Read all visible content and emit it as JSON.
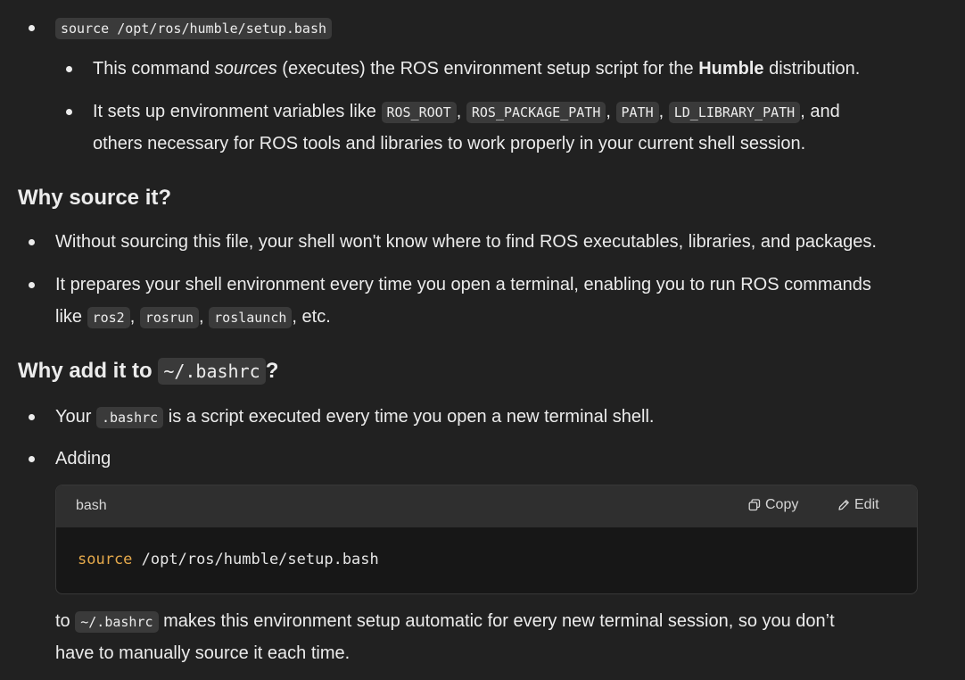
{
  "section1": {
    "command": "source /opt/ros/humble/setup.bash",
    "b1": {
      "pre": "This command ",
      "em": "sources",
      "mid": " (executes) the ROS environment setup script for the ",
      "strong": "Humble",
      "post": " distribution."
    },
    "b2": {
      "pre": "It sets up environment variables like ",
      "codes": [
        "ROS_ROOT",
        "ROS_PACKAGE_PATH",
        "PATH",
        "LD_LIBRARY_PATH"
      ],
      "sep": ", ",
      "post": ", and",
      "line2": "others necessary for ROS tools and libraries to work properly in your current shell session."
    }
  },
  "section2": {
    "heading": "Why source it?",
    "b1": "Without sourcing this file, your shell won't know where to find ROS executables, libraries, and packages.",
    "b2": {
      "line1": "It prepares your shell environment every time you open a terminal, enabling you to run ROS commands",
      "pre": "like ",
      "codes": [
        "ros2",
        "rosrun",
        "roslaunch"
      ],
      "sep": ", ",
      "post": ", etc."
    }
  },
  "section3": {
    "heading_pre": "Why add it to ",
    "heading_code": "~/.bashrc",
    "heading_post": "?",
    "b1": {
      "pre": "Your ",
      "code": ".bashrc",
      "post": " is a script executed every time you open a new terminal shell."
    },
    "b2": "Adding",
    "codeblock": {
      "lang": "bash",
      "copy_label": "Copy",
      "edit_label": "Edit",
      "keyword": "source",
      "rest": " /opt/ros/humble/setup.bash"
    },
    "after": {
      "pre": "to ",
      "code": "~/.bashrc",
      "post": " makes this environment setup automatic for every new terminal session, so you don’t",
      "line2": "have to manually source it each time."
    }
  },
  "icons": {
    "copy": "copy-icon",
    "edit": "pencil-icon"
  }
}
